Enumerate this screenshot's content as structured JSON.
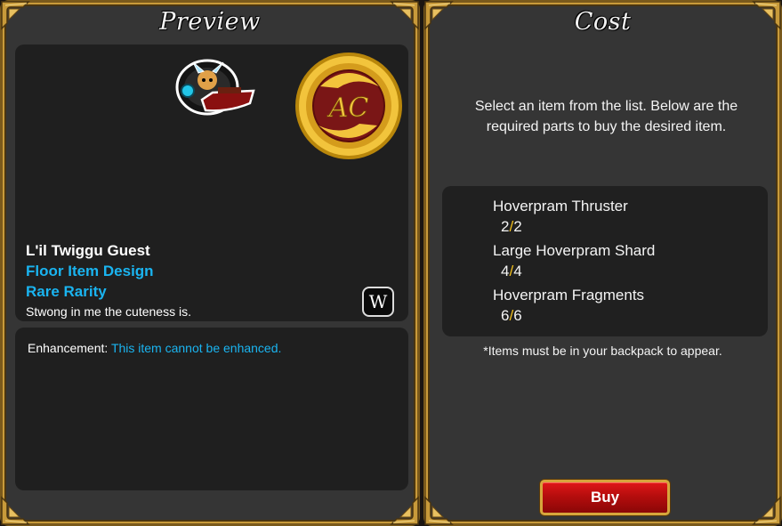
{
  "preview": {
    "title": "Preview",
    "item_name": "L'il Twiggu Guest",
    "item_type": "Floor Item Design",
    "item_rarity": "Rare Rarity",
    "item_description": "Stwong in me the cuteness is.",
    "wiki_button_label": "W",
    "coin_label": "AC",
    "enhancement_label": "Enhancement:",
    "enhancement_value": "This item cannot be enhanced."
  },
  "cost": {
    "title": "Cost",
    "instructions": "Select an item from the list. Below are the required parts to buy the desired item.",
    "parts": [
      {
        "name": "Hoverpram Thruster",
        "have": "2",
        "sep": "/",
        "need": "2"
      },
      {
        "name": "Large Hoverpram Shard",
        "have": "4",
        "sep": "/",
        "need": "4"
      },
      {
        "name": "Hoverpram Fragments",
        "have": "6",
        "sep": "/",
        "need": "6"
      }
    ],
    "footnote": "*Items must be in your backpack to appear.",
    "buy_label": "Buy"
  },
  "colors": {
    "accent_blue": "#1ab4f0",
    "count_separator": "#f3c01c",
    "frame_gold": "#c89a3a",
    "buy_red": "#c01010"
  }
}
